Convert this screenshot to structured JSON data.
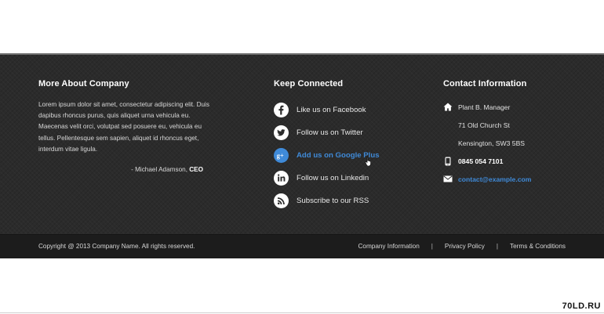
{
  "about": {
    "title": "More About Company",
    "text": "Lorem ipsum dolor sit amet, consectetur adipiscing elit. Duis dapibus rhoncus purus, quis aliquet urna vehicula eu. Maecenas velit orci, volutpat sed posuere eu, vehicula eu tellus. Pellentesque sem sapien, aliquet id rhoncus eget, interdum vitae ligula.",
    "author": "- Michael Adamson,",
    "author_role": "CEO"
  },
  "social": {
    "title": "Keep Connected",
    "items": [
      {
        "label": "Like us on Facebook",
        "icon": "facebook-icon"
      },
      {
        "label": "Follow us on Twitter",
        "icon": "twitter-icon"
      },
      {
        "label": "Add us on Google Plus",
        "icon": "google-plus-icon",
        "active": true
      },
      {
        "label": "Follow us on Linkedin",
        "icon": "linkedin-icon"
      },
      {
        "label": "Subscribe to our RSS",
        "icon": "rss-icon"
      }
    ]
  },
  "contact": {
    "title": "Contact Information",
    "name": "Plant B. Manager",
    "address_line1": "71 Old Church St",
    "address_line2": "Kensington, SW3 5BS",
    "phone": "0845 054 7101",
    "email": "contact@example.com"
  },
  "footer": {
    "copyright": "Copyright @ 2013 Company Name. All rights reserved.",
    "links": [
      "Company Information",
      "Privacy Policy",
      "Terms & Conditions"
    ],
    "separator": "|"
  },
  "watermark": "70LD.RU",
  "colors": {
    "accent": "#3f8ad8",
    "footer_bg": "#2b2b2b",
    "bottom_bg": "#1c1c1c"
  }
}
